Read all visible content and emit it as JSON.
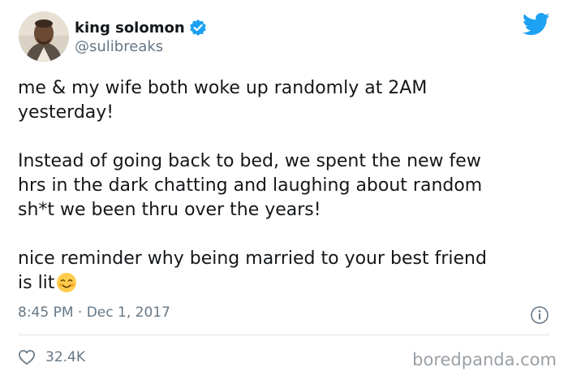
{
  "author": {
    "display_name": "king solomon",
    "handle": "@sulibreaks",
    "avatar_icon": "profile-photo",
    "verified_icon": "verified-badge-icon"
  },
  "brand": {
    "icon": "twitter-bird-icon",
    "accent_color": "#1da1f2"
  },
  "tweet": {
    "paragraphs": [
      "me & my wife both woke up randomly at 2AM\nyesterday!",
      "Instead of going back to bed, we spent the new few\nhrs in the dark chatting and laughing about random\nsh*t we been thru over the years!",
      "nice reminder why being married to your best friend\nis lit"
    ],
    "emoji": "smiling-face-with-smiling-eyes",
    "timestamp": "8:45 PM · Dec 1, 2017"
  },
  "actions": {
    "heart_icon": "heart-icon",
    "like_count": "32.4K",
    "info_icon": "info-icon"
  },
  "watermark": "boredpanda.com"
}
